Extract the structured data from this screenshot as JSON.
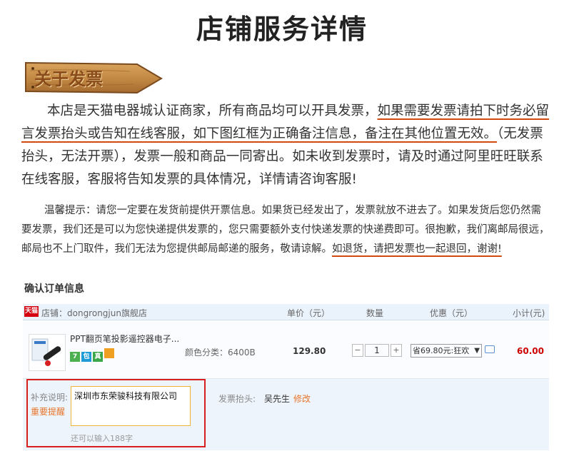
{
  "page": {
    "title": "店铺服务详情",
    "section_label": "关于发票"
  },
  "intro": {
    "p1_a": "本店是天猫电器城认证商家，所有商品均可以开具发票，",
    "p1_b": "如果需要发票请拍下时务必留言发票抬头或告知在线客服，如下图红框为正确备注信息，",
    "p1_c": "备注在其他位置无效。",
    "p1_d": "（无发票抬头，无法开票），发票一般和商品一同寄出。如未收到发票时，请及时通过阿里旺旺联系在线客服，客服将告知发票的具体情况，详情请咨询客服!",
    "p2_a": "温馨提示：请您一定要在发货前提供开票信息。如果货已经发出了，发票就放不进去了。如果发货后您仍然需要发票，我们还是可以为您快递提供发票的，您只需要额外支付快递发票的快递费即可。很抱歉，我们离邮局很远，邮局也不上门取件，我们无法为您提供邮局邮递的服务，敬请谅解。",
    "p2_b": "如退货，请把发票也一起退回，谢谢!"
  },
  "order": {
    "confirm_title": "确认订单信息",
    "tmall_badge": "天猫",
    "store_label": "店铺：dongrongjun旗舰店",
    "col_price": "单价（元）",
    "col_qty": "数量",
    "col_discount": "优惠（元）",
    "col_subtotal": "小计(元)",
    "product_name": "PPT翻页笔投影遥控器电子...",
    "spec": "颜色分类：6400B",
    "price": "129.80",
    "qty_minus": "−",
    "qty_value": "1",
    "qty_plus": "+",
    "discount": "省69.80元:狂欢",
    "subtotal": "60.00",
    "tags": [
      "7",
      "包",
      "真"
    ]
  },
  "remark": {
    "label": "补充说明:",
    "warning": "重要提醒",
    "value": "深圳市东荣骏科技有限公司",
    "hint": "还可以输入188字"
  },
  "invoice": {
    "label": "发票抬头:",
    "value": "吴先生",
    "edit": "修改"
  },
  "colors": {
    "underline": "#d04a12",
    "highlight_box": "#d81e1e",
    "subtotal": "#cc0000",
    "warning": "#e8742a",
    "table_bg": "#eaf2fc"
  }
}
